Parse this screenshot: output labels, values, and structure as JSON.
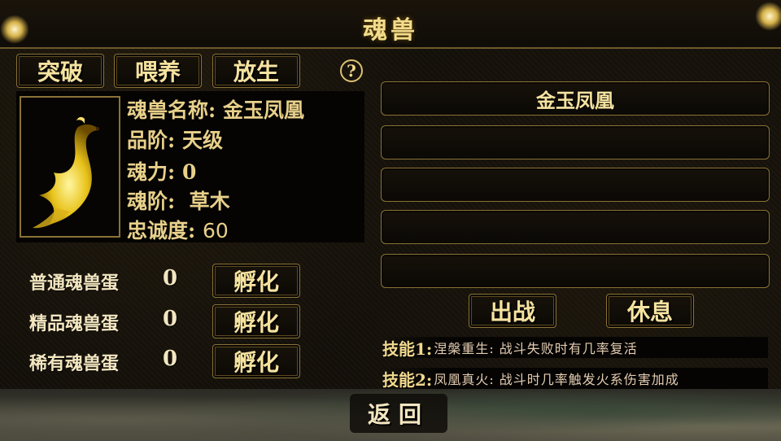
{
  "header": {
    "title": "魂兽"
  },
  "actions": {
    "breakthrough": "突破",
    "feed": "喂养",
    "release": "放生",
    "help": "?"
  },
  "beast": {
    "name_label": "魂兽名称",
    "name": "金玉凤凰",
    "grade_label": "品阶",
    "grade": "天级",
    "power_label": "魂力",
    "power": "0",
    "rank_label": "魂阶",
    "rank": "草木",
    "loyalty_label": "忠诚度",
    "loyalty": "60"
  },
  "eggs": [
    {
      "label": "普通魂兽蛋",
      "count": "0",
      "button": "孵化"
    },
    {
      "label": "精品魂兽蛋",
      "count": "0",
      "button": "孵化"
    },
    {
      "label": "稀有魂兽蛋",
      "count": "0",
      "button": "孵化"
    }
  ],
  "slots": [
    "金玉凤凰",
    "",
    "",
    "",
    ""
  ],
  "controls": {
    "deploy": "出战",
    "rest": "休息"
  },
  "skills": [
    {
      "label": "技能1:",
      "desc": "涅槃重生: 战斗失败时有几率复活"
    },
    {
      "label": "技能2:",
      "desc": "凤凰真火: 战斗时几率触发火系伤害加成"
    }
  ],
  "footer": {
    "back": "返回"
  },
  "colors": {
    "gold": "#f0d98a",
    "border": "#8a7236",
    "background": "#120f0a"
  },
  "icons": {
    "help": "question-circle-icon",
    "portrait": "golden-phoenix"
  }
}
